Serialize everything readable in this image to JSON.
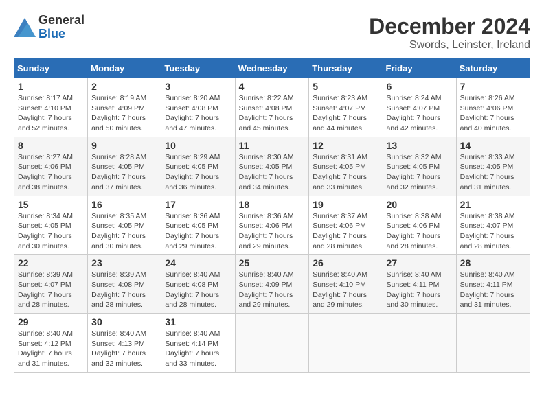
{
  "logo": {
    "general": "General",
    "blue": "Blue"
  },
  "title": "December 2024",
  "location": "Swords, Leinster, Ireland",
  "days_of_week": [
    "Sunday",
    "Monday",
    "Tuesday",
    "Wednesday",
    "Thursday",
    "Friday",
    "Saturday"
  ],
  "weeks": [
    [
      {
        "day": "1",
        "sunrise": "8:17 AM",
        "sunset": "4:10 PM",
        "daylight": "7 hours and 52 minutes."
      },
      {
        "day": "2",
        "sunrise": "8:19 AM",
        "sunset": "4:09 PM",
        "daylight": "7 hours and 50 minutes."
      },
      {
        "day": "3",
        "sunrise": "8:20 AM",
        "sunset": "4:08 PM",
        "daylight": "7 hours and 47 minutes."
      },
      {
        "day": "4",
        "sunrise": "8:22 AM",
        "sunset": "4:08 PM",
        "daylight": "7 hours and 45 minutes."
      },
      {
        "day": "5",
        "sunrise": "8:23 AM",
        "sunset": "4:07 PM",
        "daylight": "7 hours and 44 minutes."
      },
      {
        "day": "6",
        "sunrise": "8:24 AM",
        "sunset": "4:07 PM",
        "daylight": "7 hours and 42 minutes."
      },
      {
        "day": "7",
        "sunrise": "8:26 AM",
        "sunset": "4:06 PM",
        "daylight": "7 hours and 40 minutes."
      }
    ],
    [
      {
        "day": "8",
        "sunrise": "8:27 AM",
        "sunset": "4:06 PM",
        "daylight": "7 hours and 38 minutes."
      },
      {
        "day": "9",
        "sunrise": "8:28 AM",
        "sunset": "4:05 PM",
        "daylight": "7 hours and 37 minutes."
      },
      {
        "day": "10",
        "sunrise": "8:29 AM",
        "sunset": "4:05 PM",
        "daylight": "7 hours and 36 minutes."
      },
      {
        "day": "11",
        "sunrise": "8:30 AM",
        "sunset": "4:05 PM",
        "daylight": "7 hours and 34 minutes."
      },
      {
        "day": "12",
        "sunrise": "8:31 AM",
        "sunset": "4:05 PM",
        "daylight": "7 hours and 33 minutes."
      },
      {
        "day": "13",
        "sunrise": "8:32 AM",
        "sunset": "4:05 PM",
        "daylight": "7 hours and 32 minutes."
      },
      {
        "day": "14",
        "sunrise": "8:33 AM",
        "sunset": "4:05 PM",
        "daylight": "7 hours and 31 minutes."
      }
    ],
    [
      {
        "day": "15",
        "sunrise": "8:34 AM",
        "sunset": "4:05 PM",
        "daylight": "7 hours and 30 minutes."
      },
      {
        "day": "16",
        "sunrise": "8:35 AM",
        "sunset": "4:05 PM",
        "daylight": "7 hours and 30 minutes."
      },
      {
        "day": "17",
        "sunrise": "8:36 AM",
        "sunset": "4:05 PM",
        "daylight": "7 hours and 29 minutes."
      },
      {
        "day": "18",
        "sunrise": "8:36 AM",
        "sunset": "4:06 PM",
        "daylight": "7 hours and 29 minutes."
      },
      {
        "day": "19",
        "sunrise": "8:37 AM",
        "sunset": "4:06 PM",
        "daylight": "7 hours and 28 minutes."
      },
      {
        "day": "20",
        "sunrise": "8:38 AM",
        "sunset": "4:06 PM",
        "daylight": "7 hours and 28 minutes."
      },
      {
        "day": "21",
        "sunrise": "8:38 AM",
        "sunset": "4:07 PM",
        "daylight": "7 hours and 28 minutes."
      }
    ],
    [
      {
        "day": "22",
        "sunrise": "8:39 AM",
        "sunset": "4:07 PM",
        "daylight": "7 hours and 28 minutes."
      },
      {
        "day": "23",
        "sunrise": "8:39 AM",
        "sunset": "4:08 PM",
        "daylight": "7 hours and 28 minutes."
      },
      {
        "day": "24",
        "sunrise": "8:40 AM",
        "sunset": "4:08 PM",
        "daylight": "7 hours and 28 minutes."
      },
      {
        "day": "25",
        "sunrise": "8:40 AM",
        "sunset": "4:09 PM",
        "daylight": "7 hours and 29 minutes."
      },
      {
        "day": "26",
        "sunrise": "8:40 AM",
        "sunset": "4:10 PM",
        "daylight": "7 hours and 29 minutes."
      },
      {
        "day": "27",
        "sunrise": "8:40 AM",
        "sunset": "4:11 PM",
        "daylight": "7 hours and 30 minutes."
      },
      {
        "day": "28",
        "sunrise": "8:40 AM",
        "sunset": "4:11 PM",
        "daylight": "7 hours and 31 minutes."
      }
    ],
    [
      {
        "day": "29",
        "sunrise": "8:40 AM",
        "sunset": "4:12 PM",
        "daylight": "7 hours and 31 minutes."
      },
      {
        "day": "30",
        "sunrise": "8:40 AM",
        "sunset": "4:13 PM",
        "daylight": "7 hours and 32 minutes."
      },
      {
        "day": "31",
        "sunrise": "8:40 AM",
        "sunset": "4:14 PM",
        "daylight": "7 hours and 33 minutes."
      },
      null,
      null,
      null,
      null
    ]
  ]
}
